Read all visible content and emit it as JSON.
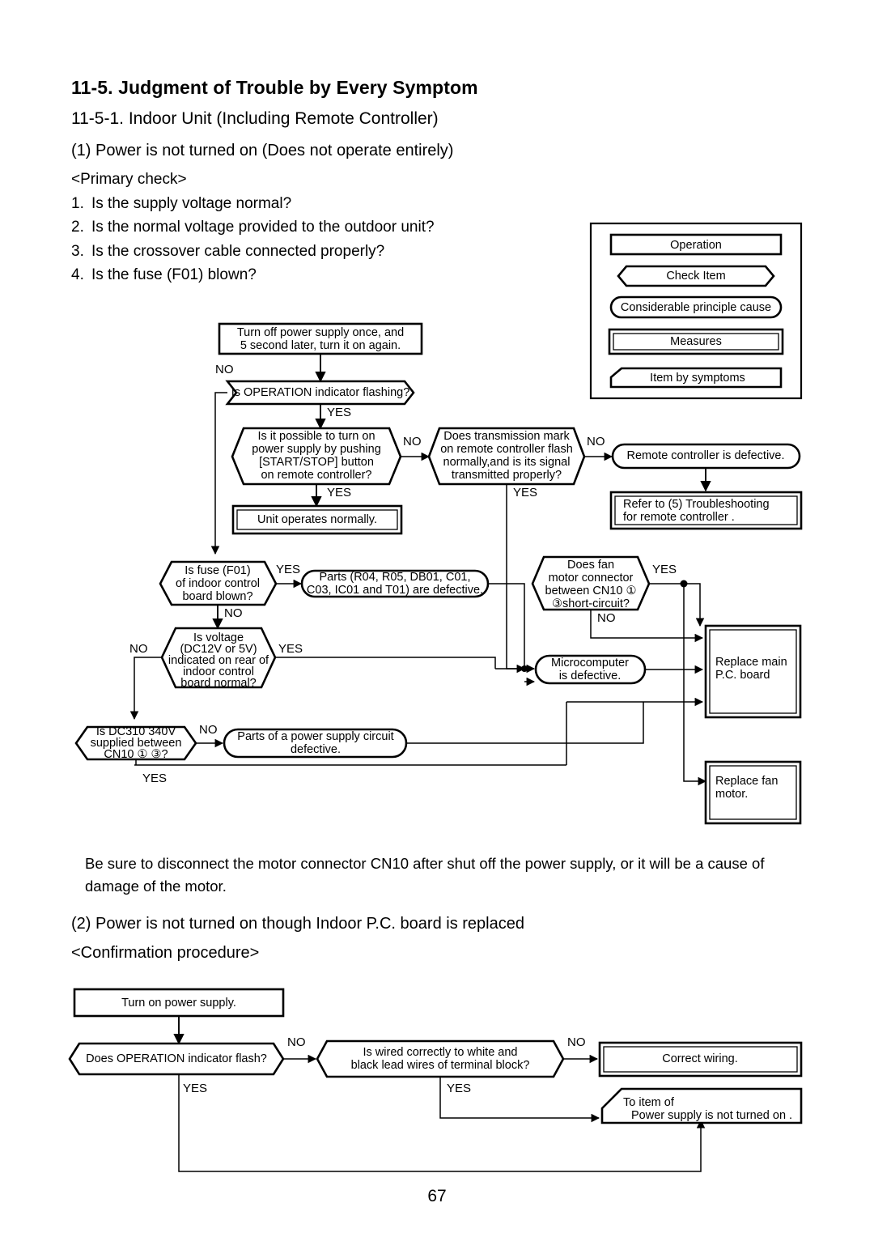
{
  "document": {
    "page_number": "67",
    "section_title": "11-5.  Judgment of Trouble by Every Symptom",
    "subsection_title": "11-5-1. Indoor Unit (Including Remote Controller)",
    "item1_title": "(1)  Power is not turned on (Does not operate entirely)",
    "primary_check_heading": "<Primary check>",
    "primary_checks": [
      {
        "num": "1.",
        "text": "Is the supply voltage normal?"
      },
      {
        "num": "2.",
        "text": "Is the normal voltage provided to the outdoor unit?"
      },
      {
        "num": "3.",
        "text": "Is the crossover cable connected properly?"
      },
      {
        "num": "4.",
        "text": "Is the fuse (F01) blown?"
      }
    ],
    "caution_note": "Be sure to disconnect the motor connector CN10 after shut off the power supply, or it will be a cause of damage of the motor.",
    "item2_title": "(2) Power is not turned on though Indoor P.C. board is replaced",
    "confirmation_heading": "<Confirmation procedure>"
  },
  "legend": {
    "items": [
      {
        "label": "Operation",
        "shape": "rect"
      },
      {
        "label": "Check Item",
        "shape": "hexagon"
      },
      {
        "label": "Considerable principle cause",
        "shape": "stadium"
      },
      {
        "label": "Measures",
        "shape": "double-rect"
      },
      {
        "label": "Item by symptoms",
        "shape": "clipped-rect"
      }
    ]
  },
  "flowchart1": {
    "nodes": {
      "turn_off_l1": "Turn off power supply once, and",
      "turn_off_l2": "5 second later, turn it on again.",
      "op_flashing": "Is OPERATION indicator flashing?",
      "possible_l1": "Is it possible to turn on",
      "possible_l2": "power supply by pushing",
      "possible_l3": "[START/STOP] button",
      "possible_l4": "on remote controller?",
      "transmission_l1": "Does transmission mark",
      "transmission_l2": "on remote controller flash",
      "transmission_l3": "normally,and is its signal",
      "transmission_l4": "transmitted properly?",
      "rc_defective": "Remote controller is defective.",
      "refer_l1": "Refer to (5)  Troubleshooting",
      "refer_l2": "for remote controller .",
      "unit_normal": "Unit operates normally.",
      "fuse_l1": "Is fuse (F01)",
      "fuse_l2": "of indoor control",
      "fuse_l3": "board blown?",
      "parts_l1": "Parts (R04, R05, DB01, C01,",
      "parts_l2": "C03, IC01 and T01) are defective.",
      "fan_l1": "Does fan",
      "fan_l2": "motor connector",
      "fan_l3": "between CN10 ①",
      "fan_l4": "③short-circuit?",
      "voltage_l1": "Is voltage",
      "voltage_l2": "(DC12V or 5V)",
      "voltage_l3": "indicated on rear of",
      "voltage_l4": "indoor control",
      "voltage_l5": "board normal?",
      "micro_l1": "Microcomputer",
      "micro_l2": "is defective.",
      "replace_main_l1": "Replace main",
      "replace_main_l2": "P.C. board",
      "dc310_l1": "Is DC310  340V",
      "dc310_l2": "supplied between",
      "dc310_l3": "CN10 ①      ③?",
      "power_parts_l1": "Parts of a power supply circuit",
      "power_parts_l2": "defective.",
      "replace_fan_l1": "Replace fan",
      "replace_fan_l2": "motor."
    },
    "edge_labels": {
      "no_1": "NO",
      "yes_1": "YES",
      "no_2": "NO",
      "yes_2": "YES",
      "no_3": "NO",
      "yes_3": "YES",
      "yes_4": "YES",
      "no_4": "NO",
      "yes_5": "YES",
      "no_5": "NO",
      "no_6": "NO",
      "yes_6": "YES",
      "no_7": "NO",
      "yes_7": "YES"
    }
  },
  "flowchart2": {
    "nodes": {
      "turn_on": "Turn on power supply.",
      "op_flash": "Does OPERATION indicator flash?",
      "wired_l1": "Is wired correctly to white and",
      "wired_l2": "black lead wires of terminal block?",
      "correct_wiring": "Correct wiring.",
      "to_item_l1": "To item of",
      "to_item_l2": "Power supply is not turned on ."
    },
    "edge_labels": {
      "no_1": "NO",
      "yes_1": "YES",
      "no_2": "NO",
      "yes_2": "YES"
    }
  }
}
